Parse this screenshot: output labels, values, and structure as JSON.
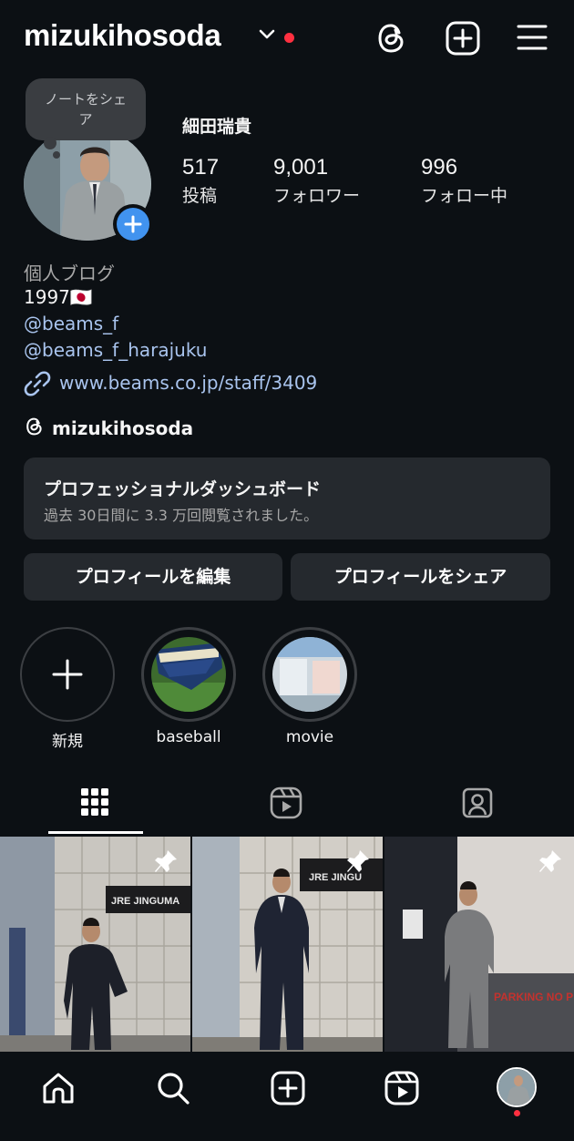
{
  "header": {
    "username": "mizukihosoda"
  },
  "profile": {
    "note_placeholder": "ノートをシェア",
    "full_name": "細田瑞貴",
    "stats": [
      {
        "value": "517",
        "label": "投稿"
      },
      {
        "value": "9,001",
        "label": "フォロワー"
      },
      {
        "value": "996",
        "label": "フォロー中"
      }
    ],
    "category": "個人ブログ",
    "bio_line": "1997🇯🇵",
    "mentions": [
      "@beams_f",
      "@beams_f_harajuku"
    ],
    "link": "www.beams.co.jp/staff/3409",
    "threads_handle": "mizukihosoda"
  },
  "dashboard": {
    "title": "プロフェッショナルダッシュボード",
    "subtitle": "過去 30日間に 3.3 万回閲覧されました。"
  },
  "buttons": {
    "edit": "プロフィールを編集",
    "share": "プロフィールをシェア"
  },
  "highlights": [
    {
      "label": "新規"
    },
    {
      "label": "baseball"
    },
    {
      "label": "movie"
    }
  ],
  "tabs": [
    {
      "icon": "grid-icon",
      "active": true
    },
    {
      "icon": "reels-icon",
      "active": false
    },
    {
      "icon": "tagged-icon",
      "active": false
    }
  ],
  "posts": [
    {
      "sign_text": "JRE JINGUMA",
      "pinned": true
    },
    {
      "sign_text": "JRE JINGU",
      "pinned": true
    },
    {
      "sign_text": "PARKING  NO P",
      "pinned": true
    }
  ],
  "colors": {
    "background": "#0c1014",
    "link": "#a9c4ee",
    "accent_blue": "#4193ef",
    "notification_red": "#ff3040",
    "surface": "#25292e"
  }
}
